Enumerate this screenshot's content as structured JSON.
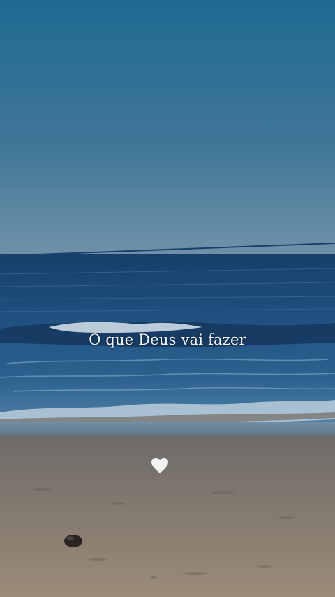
{
  "overlay": {
    "caption": "O que Deus vai fazer",
    "heart_icon": "heart-icon"
  },
  "scene": {
    "subject": "beach-ocean-horizon",
    "colors": {
      "sky_top": "#1f6a92",
      "sky_bottom": "#6f91a8",
      "sea": "#1e4f7e",
      "foam": "#dce8ef",
      "sand": "#8f8273",
      "caption_text": "#f4f6f8"
    }
  }
}
